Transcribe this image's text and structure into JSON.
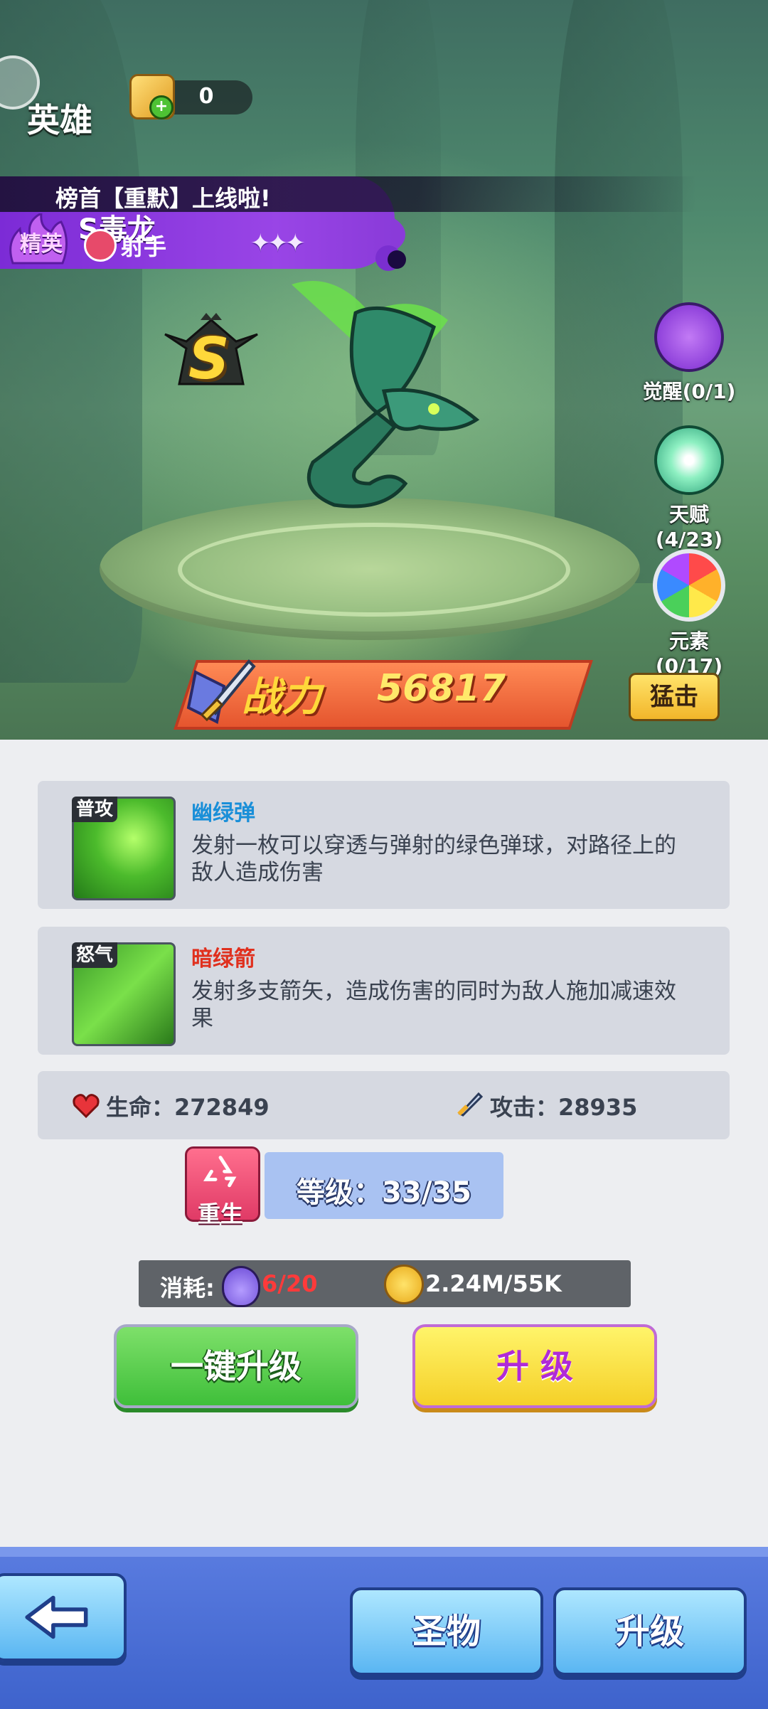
{
  "header": {
    "title": "英雄",
    "currency_value": "0"
  },
  "hero": {
    "ticker": "榜首【重默】上线啦!",
    "name": "S毒龙",
    "rarity": "精英",
    "class_label": "射手",
    "stars": "✦✦✦",
    "rank": "S"
  },
  "side_buttons": [
    {
      "label": "觉醒(0/1)",
      "icon": "awaken-book-icon"
    },
    {
      "label": "天赋(4/23)",
      "icon": "talent-star-icon"
    },
    {
      "label": "元素(0/17)",
      "icon": "element-wheel-icon"
    }
  ],
  "power": {
    "label": "战力",
    "value": "56817",
    "tag": "猛击"
  },
  "skills": [
    {
      "tag": "普攻",
      "name": "幽绿弹",
      "name_color": "#1a8fd8",
      "desc": "发射一枚可以穿透与弹射的绿色弹球，对路径上的敌人造成伤害"
    },
    {
      "tag": "怒气",
      "name": "暗绿箭",
      "name_color": "#e0301e",
      "desc": "发射多支箭矢，造成伤害的同时为敌人施加减速效果"
    }
  ],
  "stats": {
    "hp_label": "生命：272849",
    "atk_label": "攻击：28935"
  },
  "rebirth": {
    "label": "重生"
  },
  "level": {
    "label": "等级：33/35"
  },
  "cost": {
    "label": "消耗:",
    "potion": "6/20",
    "coin": "2.24M/55K"
  },
  "buttons": {
    "upgrade_all": "一键升级",
    "upgrade": "升 级"
  },
  "nav": {
    "relic": "圣物",
    "upgrade": "升级"
  }
}
